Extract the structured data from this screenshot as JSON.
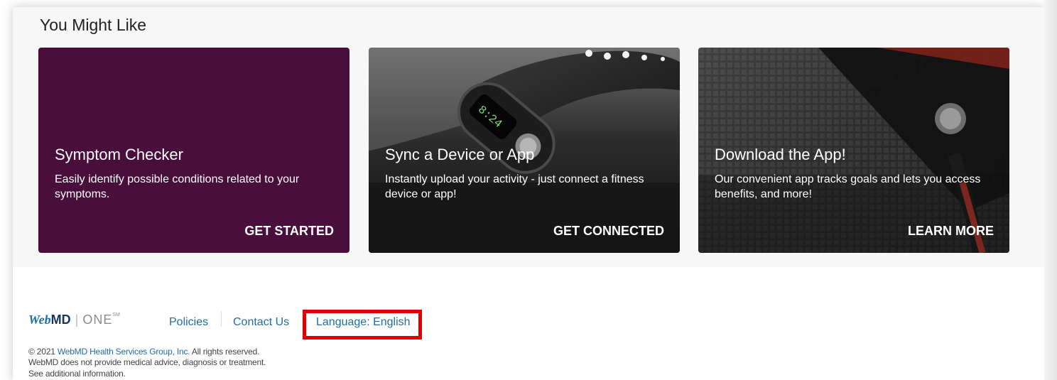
{
  "section": {
    "title": "You Might Like"
  },
  "cards": [
    {
      "title": "Symptom Checker",
      "description": "Easily identify possible conditions related to your symptoms.",
      "cta": "GET STARTED",
      "background_color": "#4a0e3d"
    },
    {
      "title": "Sync a Device or App",
      "description": "Instantly upload your activity - just connect a fitness device or app!",
      "cta": "GET CONNECTED",
      "image": "fitness-tracker-photo"
    },
    {
      "title": "Download the App!",
      "description": "Our convenient app tracks goals and lets you access benefits, and more!",
      "cta": "LEARN MORE",
      "image": "smartphone-charging-photo"
    }
  ],
  "footer": {
    "logo": {
      "web": "Web",
      "md": "MD",
      "divider": "|",
      "one": "ONE",
      "sm": "SM"
    },
    "links": {
      "policies": "Policies",
      "contact": "Contact Us",
      "language": "Language: English"
    },
    "copyright_prefix": "© 2021 ",
    "company_link": "WebMD Health Services Group, Inc.",
    "copyright_suffix": "  All rights reserved.",
    "disclaimer": "WebMD does not provide medical advice, diagnosis or treatment.",
    "additional_info": "See additional information."
  },
  "colors": {
    "link_blue": "#1f6ea6",
    "highlight_red": "#e00000",
    "card_purple": "#4a0e3d"
  }
}
